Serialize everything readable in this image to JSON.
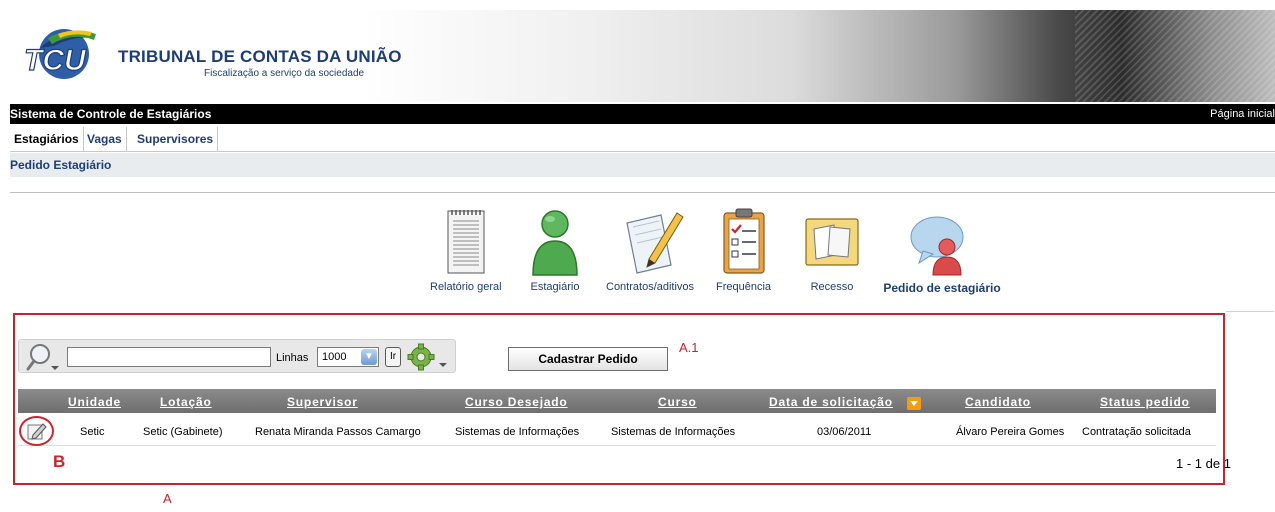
{
  "header": {
    "org_name": "TRIBUNAL DE CONTAS DA UNIÃO",
    "slogan": "Fiscalização a serviço da sociedade"
  },
  "system_bar": {
    "title": "Sistema de Controle de Estagiários",
    "home_link": "Página inicial"
  },
  "nav": {
    "tabs": [
      {
        "label": "Estagiários",
        "active": true
      },
      {
        "label": "Vagas",
        "active": false
      },
      {
        "label": "Supervisores",
        "active": false
      }
    ]
  },
  "subnav": {
    "item": "Pedido Estagiário"
  },
  "menu": {
    "items": [
      {
        "label": "Relatório geral",
        "icon": "report-icon"
      },
      {
        "label": "Estagiário",
        "icon": "person-icon"
      },
      {
        "label": "Contratos/aditivos",
        "icon": "contract-icon"
      },
      {
        "label": "Frequência",
        "icon": "checklist-icon"
      },
      {
        "label": "Recesso",
        "icon": "notes-icon"
      },
      {
        "label": "Pedido de estagiário",
        "icon": "request-icon"
      }
    ]
  },
  "toolbar": {
    "search_value": "",
    "rows_label": "Linhas",
    "rows_value": "1000",
    "go_label": "Ir",
    "register_button": "Cadastrar Pedido"
  },
  "annotations": {
    "a1": "A.1",
    "b": "B",
    "a": "A"
  },
  "table": {
    "columns": [
      "Unidade",
      "Lotação",
      "Supervisor",
      "Curso Desejado",
      "Curso",
      "Data de solicitação",
      "Candidato",
      "Status pedido"
    ],
    "rows": [
      [
        "Setic",
        "Setic (Gabinete)",
        "Renata Miranda Passos Camargo",
        "Sistemas de Informações",
        "Sistemas de Informações",
        "03/06/2011",
        "Álvaro Pereira Gomes",
        "Contratação solicitada"
      ]
    ],
    "pagination": "1 - 1 de 1"
  },
  "colors": {
    "brand_blue": "#1e3d78",
    "annotation_red": "#c0272d",
    "header_bar": "#000000",
    "sort_icon": "#f39c12"
  }
}
